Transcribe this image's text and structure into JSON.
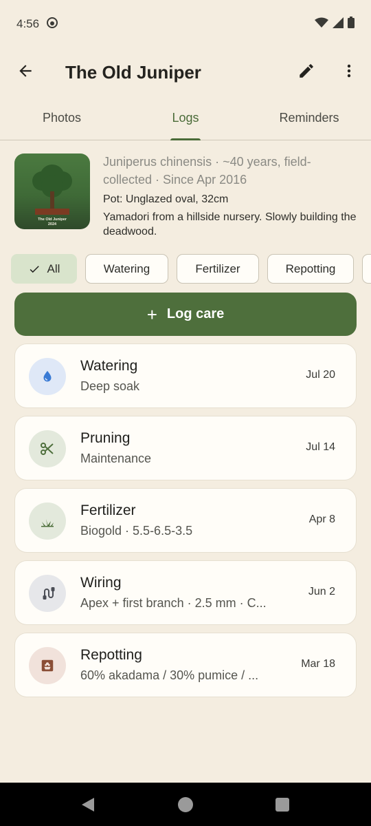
{
  "status": {
    "time": "4:56"
  },
  "app_bar": {
    "title": "The Old Juniper"
  },
  "tabs": [
    {
      "label": "Photos",
      "active": false
    },
    {
      "label": "Logs",
      "active": true
    },
    {
      "label": "Reminders",
      "active": false
    }
  ],
  "tree": {
    "thumbnail_caption_name": "The Old Juniper",
    "thumbnail_caption_year": "2024",
    "species_line": "Juniperus chinensis · ~40 years, field-collected · Since Apr 2016",
    "pot": "Pot: Unglazed oval, 32cm",
    "description": "Yamadori from a hillside nursery. Slowly building the deadwood."
  },
  "filters": [
    {
      "label": "All",
      "selected": true
    },
    {
      "label": "Watering",
      "selected": false
    },
    {
      "label": "Fertilizer",
      "selected": false
    },
    {
      "label": "Repotting",
      "selected": false
    }
  ],
  "log_care_button": {
    "plus": "+",
    "label": "Log care"
  },
  "logs": [
    {
      "title": "Watering",
      "subtitle": "Deep soak",
      "date": "Jul 20",
      "icon": "water-drop-icon",
      "icon_bg": "#dfe8f7",
      "icon_color": "#3a7bd5"
    },
    {
      "title": "Pruning",
      "subtitle": "Maintenance",
      "date": "Jul 14",
      "icon": "scissors-icon",
      "icon_bg": "#e3e9dc",
      "icon_color": "#4e6f3c"
    },
    {
      "title": "Fertilizer",
      "subtitle": "Biogold · 5.5-6.5-3.5",
      "date": "Apr 8",
      "icon": "grass-icon",
      "icon_bg": "#e3e9dc",
      "icon_color": "#4e6f3c"
    },
    {
      "title": "Wiring",
      "subtitle": "Apex + first branch · 2.5 mm · C...",
      "date": "Jun 2",
      "icon": "wire-icon",
      "icon_bg": "#e6e7ea",
      "icon_color": "#4a4d55"
    },
    {
      "title": "Repotting",
      "subtitle": "60% akadama / 30% pumice / ...",
      "date": "Mar 18",
      "icon": "flower-pot-icon",
      "icon_bg": "#f1e2db",
      "icon_color": "#8a4e36"
    }
  ],
  "colors": {
    "accent": "#4e6f3c",
    "background": "#f4ede0",
    "card": "#fffdf8",
    "chip_selected": "#d9e4cc"
  }
}
